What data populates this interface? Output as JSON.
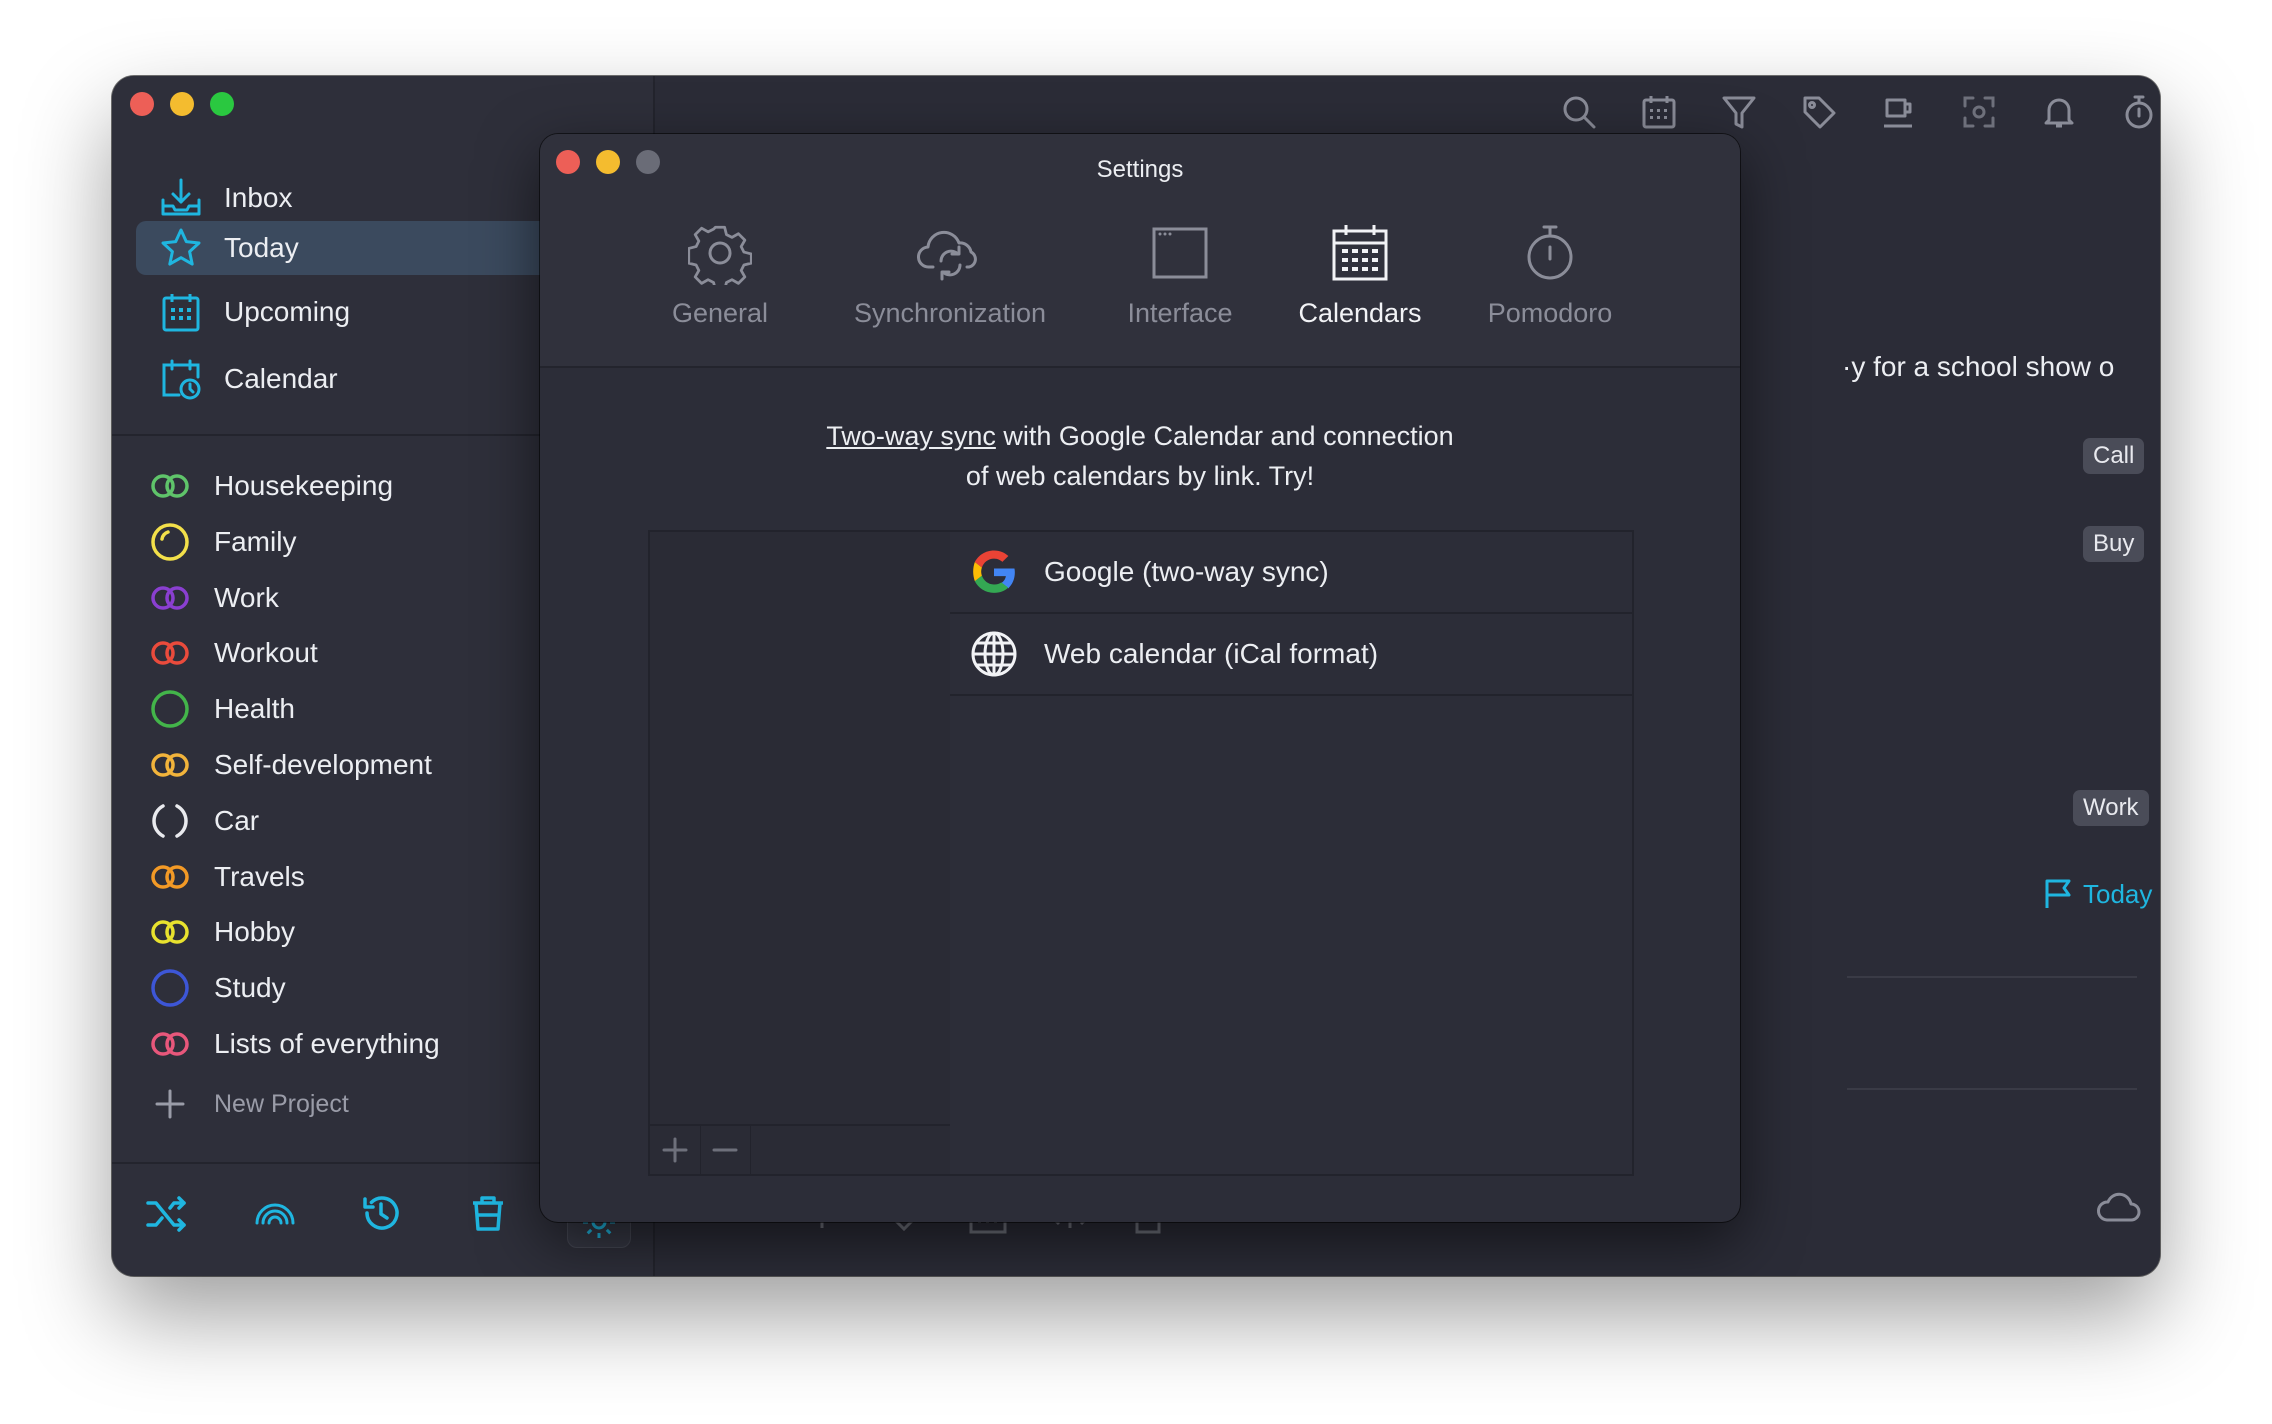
{
  "sidebar": {
    "nav": [
      {
        "label": "Inbox",
        "icon": "inbox-icon"
      },
      {
        "label": "Today",
        "icon": "star-icon",
        "selected": true
      },
      {
        "label": "Upcoming",
        "icon": "calendar-grid-icon"
      },
      {
        "label": "Calendar",
        "icon": "calendar-clock-icon"
      }
    ],
    "projects": [
      {
        "label": "Housekeeping",
        "color": "#5fc46a"
      },
      {
        "label": "Family",
        "color": "#f3e04a"
      },
      {
        "label": "Work",
        "color": "#8a3fd1"
      },
      {
        "label": "Workout",
        "color": "#ea4b3c"
      },
      {
        "label": "Health",
        "color": "#43b54a"
      },
      {
        "label": "Self-development",
        "color": "#f2b43b"
      },
      {
        "label": "Car",
        "color": "#e9eaee"
      },
      {
        "label": "Travels",
        "color": "#f39a26"
      },
      {
        "label": "Hobby",
        "color": "#e8e22e"
      },
      {
        "label": "Study",
        "color": "#3d56d6"
      },
      {
        "label": "Lists of everything",
        "color": "#e8577b"
      }
    ],
    "new_project_label": "New Project"
  },
  "main": {
    "task_snippet": "·y for a school show o",
    "badges": [
      "Call",
      "Buy",
      "Work"
    ],
    "today_label": "Today"
  },
  "settings": {
    "title": "Settings",
    "tabs": [
      {
        "label": "General",
        "icon": "gear-icon"
      },
      {
        "label": "Synchronization",
        "icon": "cloud-sync-icon"
      },
      {
        "label": "Interface",
        "icon": "window-icon"
      },
      {
        "label": "Calendars",
        "icon": "calendar-icon",
        "active": true
      },
      {
        "label": "Pomodoro",
        "icon": "stopwatch-icon"
      }
    ],
    "promo_link": "Two-way sync",
    "promo_rest_line1": " with Google Calendar and connection",
    "promo_line2": "of web calendars by link. Try!",
    "calendar_sources": [
      {
        "label": "Google (two-way sync)",
        "icon": "google-icon"
      },
      {
        "label": "Web calendar (iCal format)",
        "icon": "globe-icon"
      }
    ]
  },
  "colors": {
    "accent": "#1fb6e0",
    "selected_bg": "#3b4a5e",
    "traffic_red": "#ed5f57",
    "traffic_yellow": "#f4bc2f",
    "traffic_green": "#2ac840"
  }
}
